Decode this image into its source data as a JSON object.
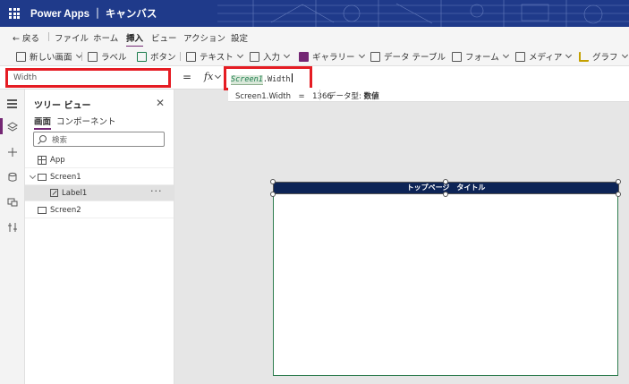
{
  "app": {
    "title": "Power Apps ｜ キャンバス"
  },
  "menu": {
    "back": "戻る",
    "items": [
      "ファイル",
      "ホーム",
      "挿入",
      "ビュー",
      "アクション",
      "設定"
    ],
    "active": "挿入"
  },
  "toolbar": {
    "new_screen": "新しい画面",
    "label": "ラベル",
    "button": "ボタン",
    "text": "テキスト",
    "input": "入力",
    "gallery": "ギャラリー",
    "data_table": "データ テーブル",
    "form": "フォーム",
    "media": "メディア",
    "chart": "グラフ"
  },
  "formula_bar": {
    "property": "Width",
    "equals": "=",
    "fx": "fx",
    "formula_ref": "Screen1",
    "formula_rest": ".Width",
    "result": "Screen1.Width　=　1366",
    "data_type_label": "データ型:",
    "data_type_value": "数値"
  },
  "tree_view": {
    "title": "ツリー ビュー",
    "tabs": [
      "画面",
      "コンポーネント"
    ],
    "active_tab": "画面",
    "search_placeholder": "検索",
    "items": [
      {
        "label": "App",
        "type": "app"
      },
      {
        "label": "Screen1",
        "type": "screen",
        "expanded": true
      },
      {
        "label": "Label1",
        "type": "label",
        "selected": true
      },
      {
        "label": "Screen2",
        "type": "screen"
      }
    ],
    "more": "···"
  },
  "canvas": {
    "label_text": "トップページ　タイトル"
  },
  "colors": {
    "title_bar": "#1f3a8a",
    "accent": "#742774",
    "highlight_box": "#e51c23",
    "label_fill": "#0d2456"
  }
}
